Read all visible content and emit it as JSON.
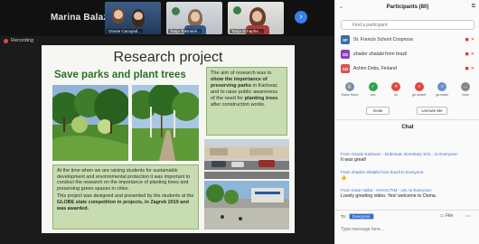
{
  "stage": {
    "speaker_name": "Marina  Balazine...",
    "recording_label": "Recording",
    "thumbnails": [
      {
        "label": "Oraxie Cacuyad..."
      },
      {
        "label": "Tanja Tokmanli..."
      },
      {
        "label": "Tanja Schaphe..."
      }
    ]
  },
  "slide": {
    "title": "Research project",
    "subtitle": "Save parks and plant trees",
    "aim_pre": "The aim of research was to ",
    "aim_bold1": "show the importance of preserving parks",
    "aim_mid": " in Karlovac and to raise public awareness of the need for ",
    "aim_bold2": "planting trees",
    "aim_post": " after construction works.",
    "desc_p1": "At the time when we are raising students for sustainable development and environmental protection it was important to conduct the research on the importance of planting trees and preserving green spaces in cities.",
    "desc_p2_pre": "This project was designed and presented by the students at the ",
    "desc_p2_bold": "GLOBE state competition in projects, in Zagreb 2019 and was awarded."
  },
  "participants": {
    "header": "Participants (80)",
    "search_placeholder": "Find a participant",
    "list": [
      {
        "initials": "SF",
        "name": "St. Francis School Cosprosa",
        "color": "#3a6ea5"
      },
      {
        "initials": "SS",
        "name": "zhader shalabi from brazil",
        "color": "#8e3fb8"
      },
      {
        "initials": "AD",
        "name": "Achim Dobs, Finland",
        "color": "#d9534f"
      }
    ],
    "controls": [
      {
        "label": "Raise Hand",
        "icon": "hand",
        "color": "#6b8fc7"
      },
      {
        "label": "yes",
        "icon": "check",
        "color": "#2ea44f"
      },
      {
        "label": "no",
        "icon": "x",
        "color": "#e0483e"
      },
      {
        "label": "go slower",
        "icon": "back",
        "color": "#e0483e"
      },
      {
        "label": "go faster",
        "icon": "fwd",
        "color": "#6b8fc7"
      },
      {
        "label": "more",
        "icon": "more",
        "color": "#888"
      }
    ],
    "invite_label": "Invite",
    "unmute_label": "Unmute Me"
  },
  "chat": {
    "header": "Chat",
    "messages": [
      {
        "from": "From Oraxie Karlovac - Dubrovat, Dometary Sch... to Everyone:",
        "text": "It was great!"
      },
      {
        "from": "From zhadon shalabi from brazil to Everyone:",
        "text": "👍"
      },
      {
        "from": "From Iman Hulka - HAYACTIM - US, to Everyone:",
        "text": "Lovely greeting video. Yes! welcome to Osma."
      }
    ],
    "to_label": "To:",
    "to_value": "Everyone",
    "file_label": "File",
    "input_placeholder": "Type message here..."
  }
}
